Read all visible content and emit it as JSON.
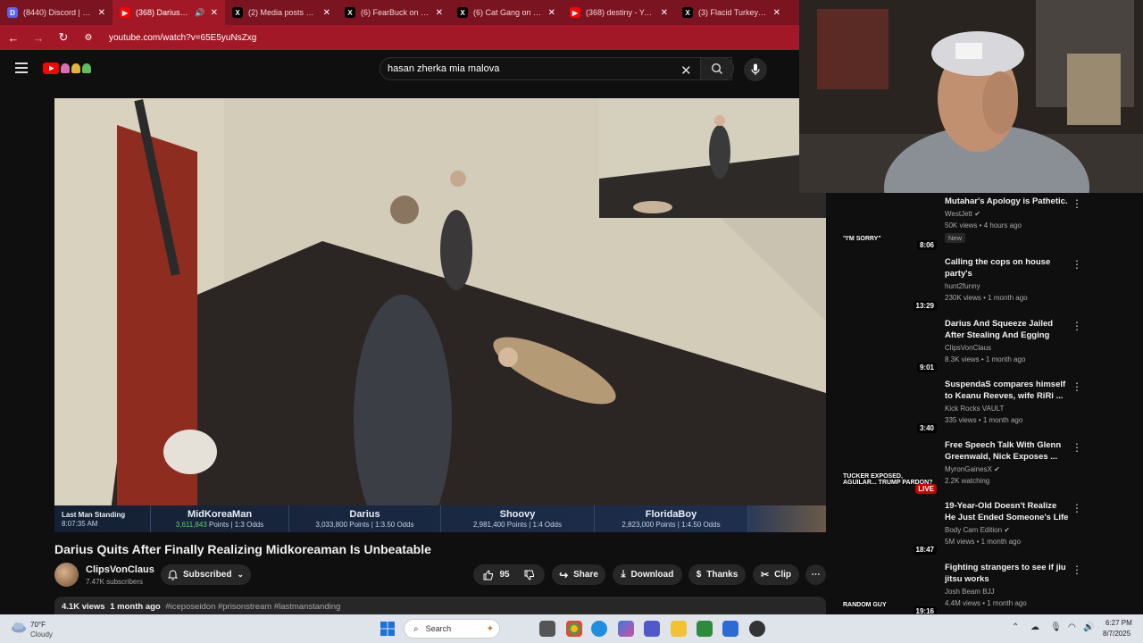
{
  "browser": {
    "tabs": [
      {
        "label": "(8440) Discord | #Clip",
        "icon": "discord-icon",
        "color": "#5865f2",
        "glyph": "D"
      },
      {
        "label": "(368) Darius Quits",
        "icon": "youtube-icon",
        "color": "#ff0000",
        "glyph": "▶",
        "active": true
      },
      {
        "label": "(2) Media posts by ye",
        "icon": "x-icon",
        "color": "#000000",
        "glyph": "X"
      },
      {
        "label": "(6) FearBuck on X: \"Be",
        "icon": "x-icon",
        "color": "#000000",
        "glyph": "X"
      },
      {
        "label": "(6) Cat Gang on X: \"N",
        "icon": "x-icon",
        "color": "#000000",
        "glyph": "X"
      },
      {
        "label": "(368) destiny - YouTu",
        "icon": "youtube-icon",
        "color": "#ff0000",
        "glyph": "▶"
      },
      {
        "label": "(3) Flacid Turkey Saus",
        "icon": "x-icon",
        "color": "#000000",
        "glyph": "X"
      }
    ],
    "url": "youtube.com/watch?v=65E5yuNsZxg"
  },
  "search": {
    "query": "hasan zherka mia malova"
  },
  "video": {
    "scoreboard": {
      "event": "Last Man Standing",
      "time": "8:07:35 AM",
      "players": [
        {
          "name": "MidKoreaMan",
          "points": "3,611,843",
          "suffix": "Points | 1:3 Odds"
        },
        {
          "name": "Darius",
          "points": "3,033,800 Points | 1:3.50 Odds"
        },
        {
          "name": "Shoovy",
          "points": "2,981,400 Points | 1:4 Odds"
        },
        {
          "name": "FloridaBoy",
          "points": "2,823,000 Points | 1:4.50 Odds"
        }
      ]
    },
    "title": "Darius Quits After Finally Realizing Midkoreaman Is Unbeatable",
    "channel": "ClipsVonClaus",
    "subscribers": "7.47K subscribers",
    "subscribe_label": "Subscribed",
    "likes": "95",
    "share_label": "Share",
    "download_label": "Download",
    "thanks_label": "Thanks",
    "clip_label": "Clip",
    "views": "4.1K views",
    "age": "1 month ago",
    "hashtags": "#iceposeidon #prisonstream #lastmanstanding"
  },
  "related": [
    {
      "title": "Mutahar's Apology is Pathetic.",
      "channel": "WestJett",
      "verified": true,
      "meta": "50K views • 4 hours ago",
      "duration": "8:06",
      "badge": "New",
      "thumb": "#7a2a20",
      "thumb_text": "\"I'M SORRY\""
    },
    {
      "title": "Calling the cops on house party's",
      "channel": "hunt2funny",
      "verified": false,
      "meta": "230K views • 1 month ago",
      "duration": "13:29",
      "thumb": "#a0607a"
    },
    {
      "title": "Darius And Squeeze Jailed After Stealing And Egging",
      "channel": "ClipsVonClaus",
      "verified": false,
      "meta": "8.3K views • 1 month ago",
      "duration": "9:01",
      "thumb": "#8a6a4a"
    },
    {
      "title": "SuspendaS compares himself to Keanu Reeves, wife RiRi ...",
      "channel": "Kick Rocks VAULT",
      "verified": false,
      "meta": "335 views • 1 month ago",
      "duration": "3:40",
      "thumb": "#3a2826"
    },
    {
      "title": "Free Speech Talk With Glenn Greenwald, Nick Exposes ...",
      "channel": "MyronGainesX",
      "verified": true,
      "meta": "2.2K watching",
      "duration": "LIVE",
      "live": true,
      "thumb": "#4a5868",
      "thumb_text": "TUCKER EXPOSED, AGUILAR... TRUMP PARDON?"
    },
    {
      "title": "19-Year-Old Doesn't Realize He Just Ended Someone's Life",
      "channel": "Body Cam Edition",
      "verified": true,
      "meta": "5M views • 1 month ago",
      "duration": "18:47",
      "thumb": "#30446a"
    },
    {
      "title": "Fighting strangers to see if jiu jitsu works",
      "channel": "Josh Beam BJJ",
      "verified": false,
      "meta": "4.4M views • 1 month ago",
      "duration": "19:16",
      "thumb": "#8ab0c8",
      "thumb_text": "RANDOM GUY"
    }
  ],
  "taskbar": {
    "temp": "70°F",
    "condition": "Cloudy",
    "search_label": "Search",
    "time": "6:27 PM",
    "date": "8/7/2025"
  }
}
